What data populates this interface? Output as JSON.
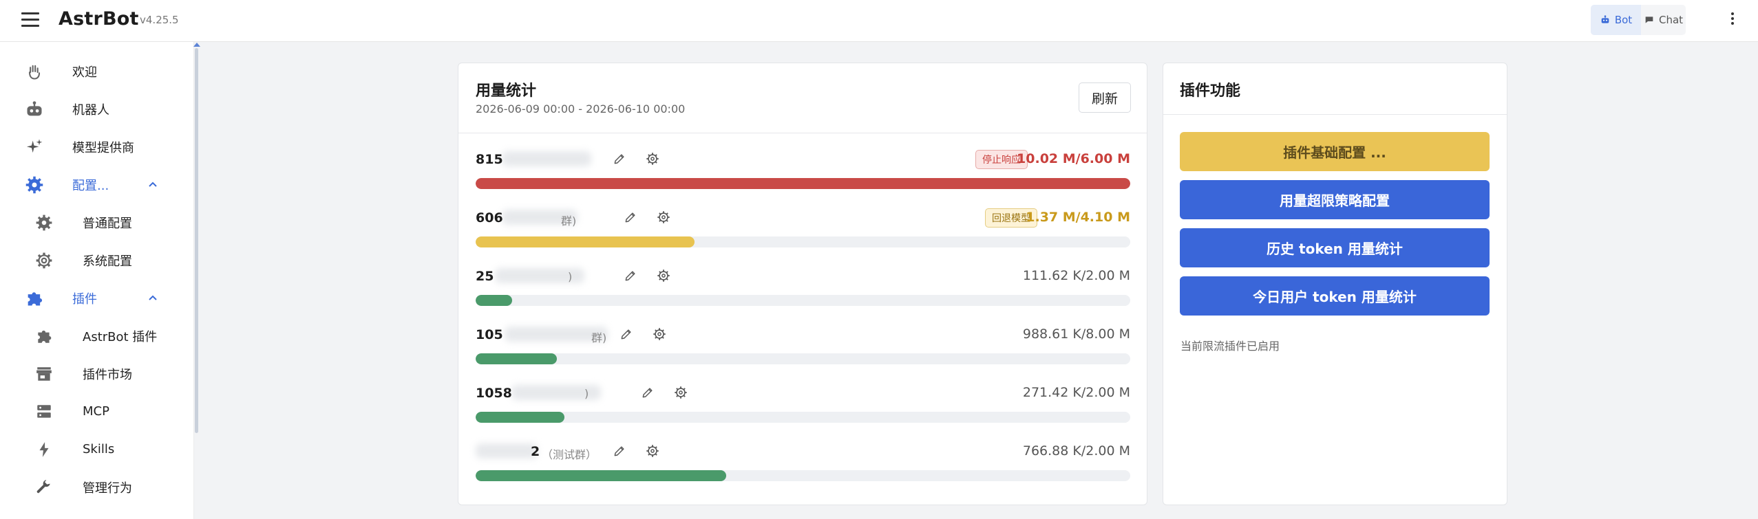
{
  "app": {
    "name": "AstrBot",
    "version": "v4.25.5",
    "modes": [
      {
        "label": "Bot",
        "active": true,
        "icon": "robot-icon"
      },
      {
        "label": "Chat",
        "active": false,
        "icon": "chat-bubble-icon"
      }
    ]
  },
  "sidebar": {
    "items": [
      {
        "label": "欢迎",
        "icon": "waving-hand-icon"
      },
      {
        "label": "机器人",
        "icon": "robot-icon"
      },
      {
        "label": "模型提供商",
        "icon": "sparkle-icon"
      },
      {
        "label": "配置...",
        "icon": "gear-icon",
        "expanded": true
      },
      {
        "label": "普通配置",
        "icon": "gear-icon"
      },
      {
        "label": "系统配置",
        "icon": "gear-outline-icon"
      },
      {
        "label": "插件",
        "icon": "puzzle-icon",
        "expanded": true
      },
      {
        "label": "AstrBot 插件",
        "icon": "puzzle-icon"
      },
      {
        "label": "插件市场",
        "icon": "store-icon"
      },
      {
        "label": "MCP",
        "icon": "server-icon"
      },
      {
        "label": "Skills",
        "icon": "lightning-icon"
      },
      {
        "label": "管理行为",
        "icon": "wrench-icon"
      }
    ]
  },
  "usage": {
    "title": "用量统计",
    "range": "2026-06-09 00:00 - 2026-06-10 00:00",
    "refresh_label": "刷新",
    "rows": [
      {
        "id": "815",
        "group": "",
        "badge": "停止响应",
        "status": "danger",
        "value": "10.02 M/6.00 M",
        "progress": 1.0
      },
      {
        "id": "606",
        "group": "群)",
        "badge": "回退模型",
        "status": "warn",
        "value": "1.37 M/4.10 M",
        "progress": 0.334
      },
      {
        "id": "25",
        "group": ")",
        "badge": "",
        "status": "ok",
        "value": "111.62 K/2.00 M",
        "progress": 0.056
      },
      {
        "id": "105",
        "group": "群)",
        "badge": "",
        "status": "ok",
        "value": "988.61 K/8.00 M",
        "progress": 0.124
      },
      {
        "id": "1058",
        "group": ")",
        "badge": "",
        "status": "ok",
        "value": "271.42 K/2.00 M",
        "progress": 0.136
      },
      {
        "id": "2",
        "group": "（测试群）",
        "badge": "",
        "status": "ok",
        "value": "766.88 K/2.00 M",
        "progress": 0.383
      }
    ]
  },
  "plugin": {
    "title": "插件功能",
    "buttons": [
      {
        "label": "插件基础配置 ...",
        "style": "gold"
      },
      {
        "label": "用量超限策略配置",
        "style": "blue"
      },
      {
        "label": "历史 token 用量统计",
        "style": "blue"
      },
      {
        "label": "今日用户 token 用量统计",
        "style": "blue"
      }
    ],
    "status": "当前限流插件已启用"
  },
  "colors": {
    "primary": "#3a66d9",
    "danger": "#c9403c",
    "warning": "#eac455",
    "success": "#4a9a6a"
  }
}
